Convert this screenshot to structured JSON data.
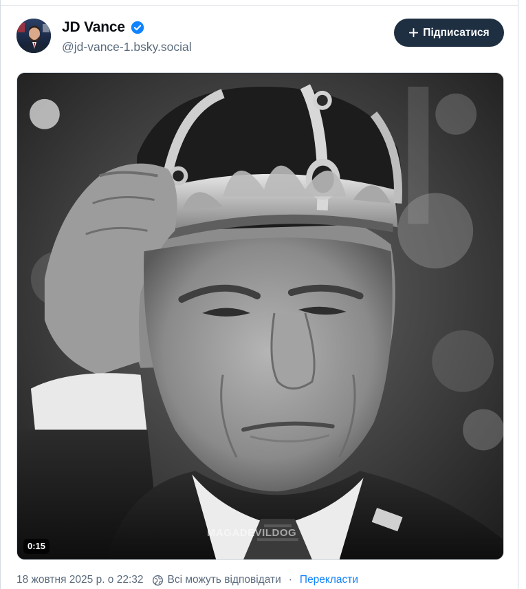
{
  "author": {
    "display_name": "JD Vance",
    "handle": "@jd-vance-1.bsky.social",
    "verified": true,
    "avatar_icon": "avatar-photo"
  },
  "follow_button": {
    "label": "Підписатися",
    "icon": "plus-icon"
  },
  "media": {
    "type": "video",
    "duration": "0:15",
    "watermark": "MAGADEVILDOG"
  },
  "meta": {
    "timestamp": "18 жовтня 2025 р. о 22:32",
    "reply_icon": "globe-icon",
    "reply_setting": "Всі можуть відповідати",
    "separator": "·",
    "translate_label": "Перекласти"
  },
  "colors": {
    "accent": "#1083fe",
    "button_bg": "#1f2f42",
    "verified": "#1083fe",
    "muted_text": "#5b6b7d",
    "border": "#d4dbe2"
  }
}
